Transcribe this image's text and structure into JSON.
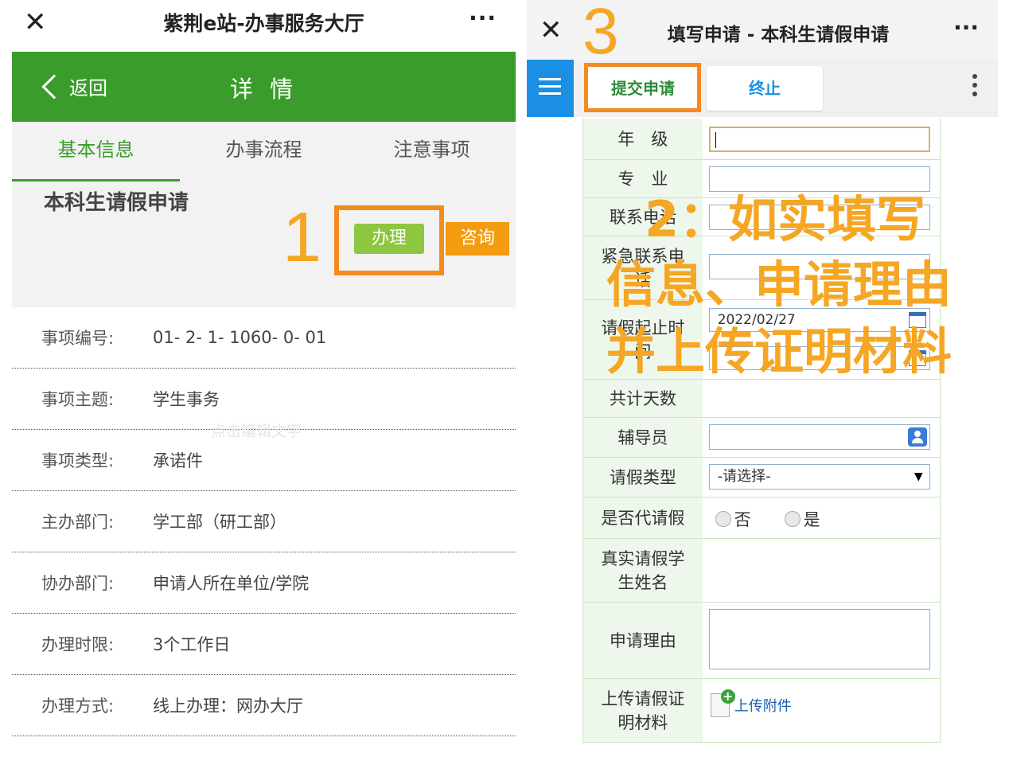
{
  "left": {
    "title": "紫荆e站-办事服务大厅",
    "close_icon": "✕",
    "more_icon": "···",
    "back_label": "返回",
    "page_title": "详 情",
    "tabs": [
      "基本信息",
      "办事流程",
      "注意事项"
    ],
    "item_name": "本科生请假申请",
    "handle_label": "办理",
    "consult_label": "咨询",
    "step_number": "1",
    "watermark": "点击编辑文字",
    "details": [
      {
        "label": "事项编号:",
        "value": "01- 2- 1- 1060- 0- 01"
      },
      {
        "label": "事项主题:",
        "value": "学生事务"
      },
      {
        "label": "事项类型:",
        "value": "承诺件"
      },
      {
        "label": "主办部门:",
        "value": "学工部（研工部）"
      },
      {
        "label": "协办部门:",
        "value": "申请人所在单位/学院"
      },
      {
        "label": "办理时限:",
        "value": "3个工作日"
      },
      {
        "label": "办理方式:",
        "value": "线上办理：网办大厅"
      }
    ],
    "colors": {
      "green": "#3a9d2b",
      "handle": "#8dc63f",
      "consult": "#f39c12",
      "highlight": "#f58a1f"
    }
  },
  "right": {
    "title": "填写申请 - 本科生请假申请",
    "close_icon": "✕",
    "more_icon": "···",
    "step_number": "3",
    "submit_label": "提交申请",
    "stop_label": "终止",
    "form": {
      "grade": "年　级",
      "major": "专　业",
      "phone": "联系电话",
      "emergency": "紧急联系电话",
      "leave_start": "请假起止时间",
      "leave_start_value": "2022/02/27",
      "total_days": "共计天数",
      "counselor": "辅导员",
      "leave_type": "请假类型",
      "leave_type_value": "-请选择-",
      "proxy": "是否代请假",
      "proxy_no": "否",
      "proxy_yes": "是",
      "real_name": "真实请假学生姓名",
      "reason": "申请理由",
      "upload_label": "上传请假证明材料",
      "upload_link": "上传附件"
    },
    "overlay_step2": "2：如实填写",
    "overlay_line2": "信息、申请理由",
    "overlay_line3": "并上传证明材料",
    "colors": {
      "menu": "#1a8fe3",
      "submit": "#2f8b3a",
      "label_bg": "#eef7ec",
      "overlay": "#f5a623"
    }
  }
}
